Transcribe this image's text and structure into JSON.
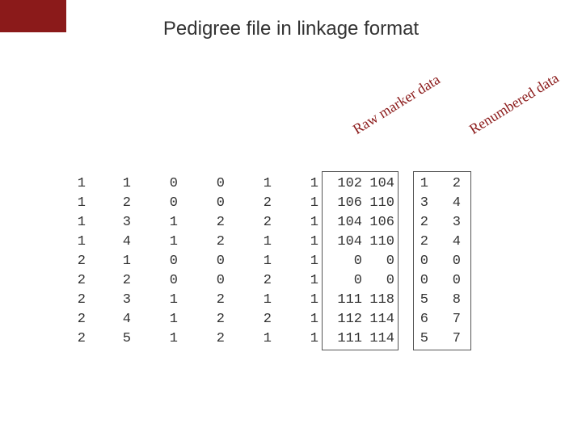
{
  "title": "Pedigree file in linkage format",
  "labels": {
    "raw": "Raw marker data",
    "renumbered": "Renumbered data"
  },
  "columns": {
    "fam": [
      "1",
      "1",
      "1",
      "1",
      "2",
      "2",
      "2",
      "2",
      "2"
    ],
    "ind": [
      "1",
      "2",
      "3",
      "4",
      "1",
      "2",
      "3",
      "4",
      "5"
    ],
    "father": [
      "0",
      "0",
      "1",
      "1",
      "0",
      "0",
      "1",
      "1",
      "1"
    ],
    "mother": [
      "0",
      "0",
      "2",
      "2",
      "0",
      "0",
      "2",
      "2",
      "2"
    ],
    "sex": [
      "1",
      "2",
      "2",
      "1",
      "1",
      "2",
      "1",
      "2",
      "1"
    ],
    "aff": [
      "1",
      "1",
      "1",
      "1",
      "1",
      "1",
      "1",
      "1",
      "1"
    ],
    "raw_a": [
      "102",
      "106",
      "104",
      "104",
      "0",
      "0",
      "111",
      "112",
      "111"
    ],
    "raw_b": [
      "104",
      "110",
      "106",
      "110",
      "0",
      "0",
      "118",
      "114",
      "114"
    ],
    "ren_a": [
      "1",
      "3",
      "2",
      "2",
      "0",
      "0",
      "5",
      "6",
      "5"
    ],
    "ren_b": [
      "2",
      "4",
      "3",
      "4",
      "0",
      "0",
      "8",
      "7",
      "7"
    ]
  }
}
